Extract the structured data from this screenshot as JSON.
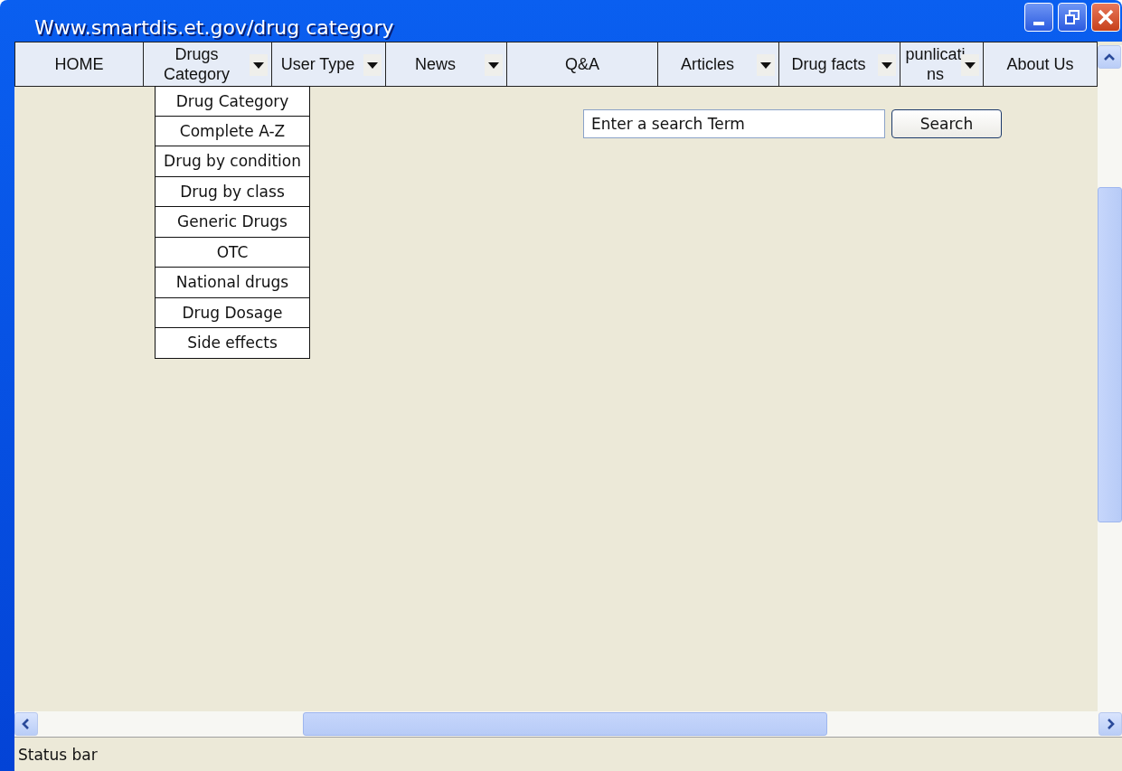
{
  "window": {
    "title": "Www.smartdis.et.gov/drug category"
  },
  "nav": [
    {
      "label": "HOME",
      "kind": "plain"
    },
    {
      "label": "Drugs Category",
      "kind": "dropdown",
      "menu": [
        "Drug Category",
        "Complete A-Z",
        "Drug by condition",
        "Drug by class",
        "Generic Drugs",
        "OTC",
        "National drugs",
        "Drug Dosage",
        "Side effects"
      ]
    },
    {
      "label": "User Type",
      "kind": "dropdown"
    },
    {
      "label": "News",
      "kind": "dropdown"
    },
    {
      "label": "Q&A",
      "kind": "plain"
    },
    {
      "label": "Articles",
      "kind": "dropdown"
    },
    {
      "label": "Drug facts",
      "kind": "dropdown"
    },
    {
      "label": "punlicati ns",
      "kind": "dropdown"
    },
    {
      "label": "About Us",
      "kind": "plain"
    }
  ],
  "search": {
    "placeholder": "Enter a search Term",
    "button": "Search"
  },
  "status_bar": "Status bar"
}
